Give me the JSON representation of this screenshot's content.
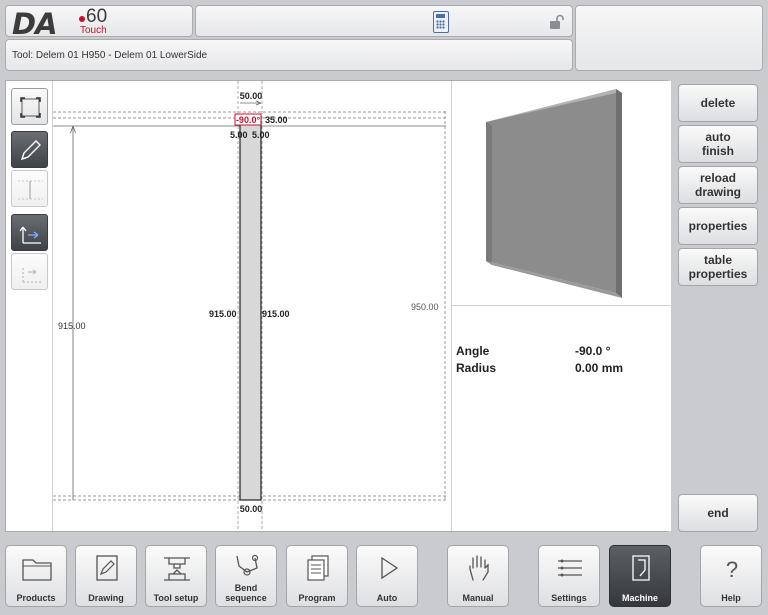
{
  "logo": {
    "brand": "DA",
    "model": "60",
    "variant": "Touch"
  },
  "tool_bar": {
    "label": "Tool: Delem 01 H950 - Delem 01 LowerSide"
  },
  "drawing": {
    "top_width": "50.00",
    "angle_tag": "-90.0°",
    "flange": "35.00",
    "left_inner": "5.00",
    "right_inner": "5.00",
    "left_height": "915.00",
    "inner_left_height": "915.00",
    "inner_right_height": "915.00",
    "total_height": "950.00",
    "bottom_width": "50.00"
  },
  "properties": [
    {
      "label": "Angle",
      "value": "-90.0 °"
    },
    {
      "label": "Radius",
      "value": "0.00 mm"
    }
  ],
  "side_buttons": {
    "delete": "delete",
    "auto_finish": "auto\nfinish",
    "reload_drawing": "reload\ndrawing",
    "properties": "properties",
    "table_properties": "table\nproperties",
    "end": "end"
  },
  "nav": {
    "products": "Products",
    "drawing": "Drawing",
    "tool_setup": "Tool setup",
    "bend_sequence": "Bend\nsequence",
    "program": "Program",
    "auto": "Auto",
    "manual": "Manual",
    "settings": "Settings",
    "machine": "Machine",
    "help": "Help"
  },
  "colors": {
    "accent_red": "#c8102e",
    "active_nav": "#3f4247",
    "part_fill": "#8c8c8c"
  }
}
